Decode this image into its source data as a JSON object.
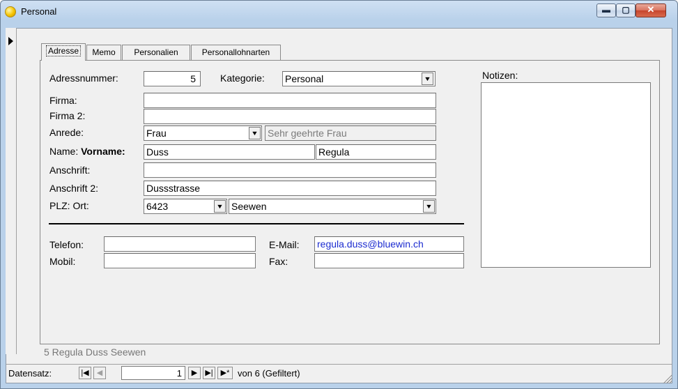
{
  "window": {
    "title": "Personal",
    "buttons": {
      "minimize": "▬",
      "maximize": "▢",
      "close": "✕"
    }
  },
  "tabs": [
    "Adresse",
    "Memo",
    "Personalien",
    "Personallohnarten"
  ],
  "form": {
    "adressnummer_label": "Adressnummer:",
    "adressnummer_value": "5",
    "kategorie_label": "Kategorie:",
    "kategorie_value": "Personal",
    "firma_label": "Firma:",
    "firma_value": "",
    "firma2_label": "Firma 2:",
    "firma2_value": "",
    "anrede_label": "Anrede:",
    "anrede_value": "Frau",
    "briefanrede_value": "Sehr geehrte Frau",
    "name_label": "Name:",
    "vorname_label": "Vorname:",
    "name_value": "Duss",
    "vorname_value": "Regula",
    "anschrift_label": "Anschrift:",
    "anschrift_value": "",
    "anschrift2_label": "Anschrift 2:",
    "anschrift2_value": "Dussstrasse",
    "plz_ort_label": "PLZ: Ort:",
    "plz_value": "6423",
    "ort_value": "Seewen",
    "telefon_label": "Telefon:",
    "telefon_value": "",
    "mobil_label": "Mobil:",
    "mobil_value": "",
    "email_label": "E-Mail:",
    "email_value": "regula.duss@bluewin.ch",
    "fax_label": "Fax:",
    "fax_value": "",
    "notizen_label": "Notizen:",
    "notizen_value": ""
  },
  "footer_text": "5  Regula Duss Seewen",
  "navigation": {
    "label": "Datensatz:",
    "current_record": "1",
    "count_text": "von 6 (Gefiltert)",
    "first": "|◀",
    "prev": "◀",
    "next": "▶",
    "last": "▶|",
    "new": "▶*"
  }
}
